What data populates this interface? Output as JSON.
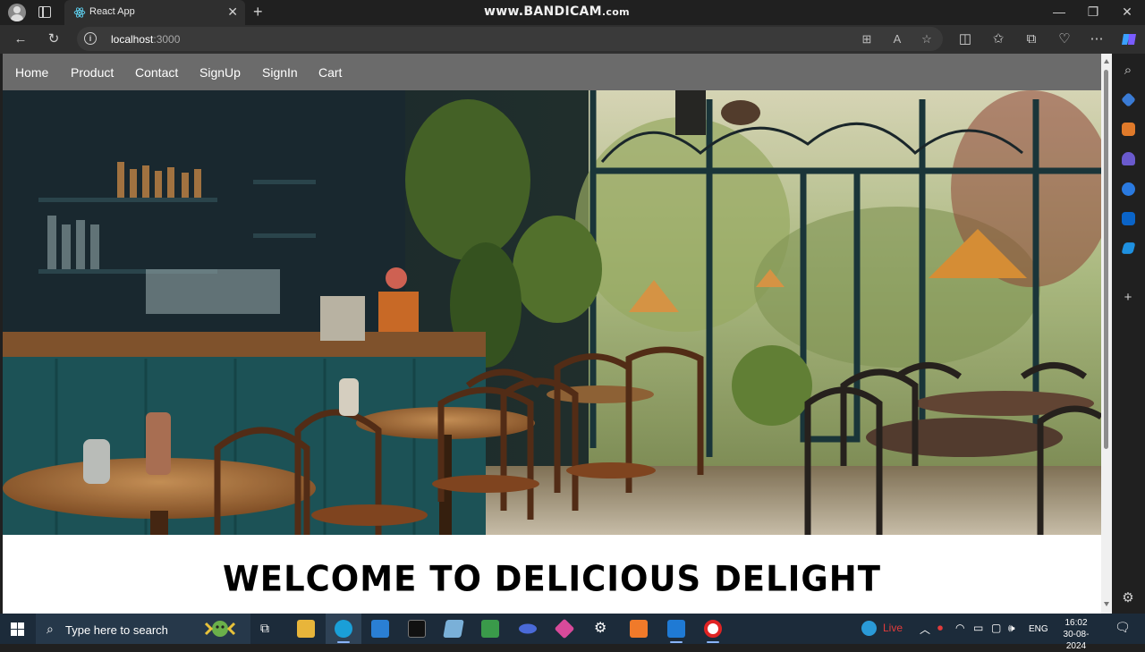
{
  "browser": {
    "tab_title": "React App",
    "tab_close": "✕",
    "new_tab": "+",
    "watermark_main": "www.BANDICAM",
    "watermark_suffix": ".com",
    "url_host": "localhost",
    "url_port": ":3000",
    "win_minimize": "—",
    "win_maximize": "❐",
    "win_close": "✕"
  },
  "site": {
    "nav": [
      {
        "label": "Home"
      },
      {
        "label": "Product"
      },
      {
        "label": "Contact"
      },
      {
        "label": "SignUp"
      },
      {
        "label": "SignIn"
      },
      {
        "label": "Cart"
      }
    ],
    "welcome": "WELCOME TO DELICIOUS DELIGHT"
  },
  "taskbar": {
    "search_placeholder": "Type here to search",
    "weather_label": "Live",
    "language": "ENG",
    "time": "16:02",
    "date": "30-08-2024"
  },
  "colors": {
    "navbar": "#6b6b6b",
    "browser_chrome": "#202020",
    "taskbar": "#1c2b3a"
  }
}
